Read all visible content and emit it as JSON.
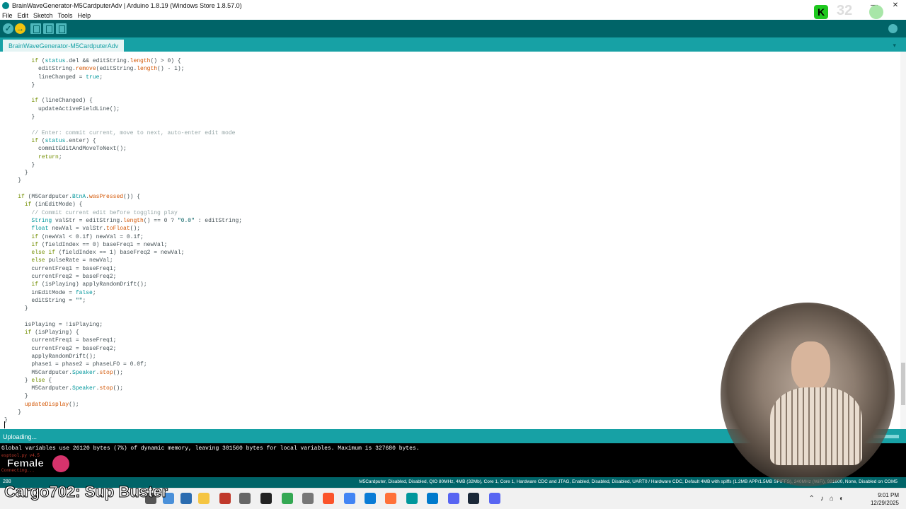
{
  "window": {
    "title": "BrainWaveGenerator-M5CardputerAdv | Arduino 1.8.19 (Windows Store 1.8.57.0)",
    "minimize": "—",
    "close": "✕"
  },
  "menu": [
    "File",
    "Edit",
    "Sketch",
    "Tools",
    "Help"
  ],
  "toolbar": {
    "verify": "✓",
    "upload": "→",
    "new_icon": "new-sketch-icon",
    "open_icon": "open-icon",
    "save_icon": "save-icon",
    "serial_icon": "serial-monitor-icon"
  },
  "tab": {
    "label": "BrainWaveGenerator-M5CardputerAdv",
    "menu": "▾"
  },
  "status": {
    "text": "Uploading..."
  },
  "console": {
    "line1": "Global variables use 26120 bytes (7%) of dynamic memory, leaving 301560 bytes for local variables. Maximum is 327680 bytes.",
    "line2": "esptool.py v4.5",
    "line3": "Connecting..."
  },
  "boardbar": {
    "line": "288",
    "info": "M5Cardputer, Disabled, Disabled, QIO 80MHz, 4MB (32Mb), Core 1, Core 1, Hardware CDC and JTAG, Enabled, Disabled, Disabled, UART0 / Hardware CDC, Default 4MB with spiffs (1.2MB APP/1.5MB SPIFFS), 240MHz (WiFi), 921600, None, Disabled on COM5"
  },
  "taskbar": {
    "time": "9:01 PM",
    "date": "12/29/2025"
  },
  "overlay": {
    "brand": "K",
    "number": "32",
    "gender": "Female",
    "chat": "Cargo702: Sup Buster"
  },
  "colors": {
    "toolbar": "#006468",
    "tabbar": "#17a1a5",
    "keyword": "#728e00",
    "function": "#d35400"
  }
}
